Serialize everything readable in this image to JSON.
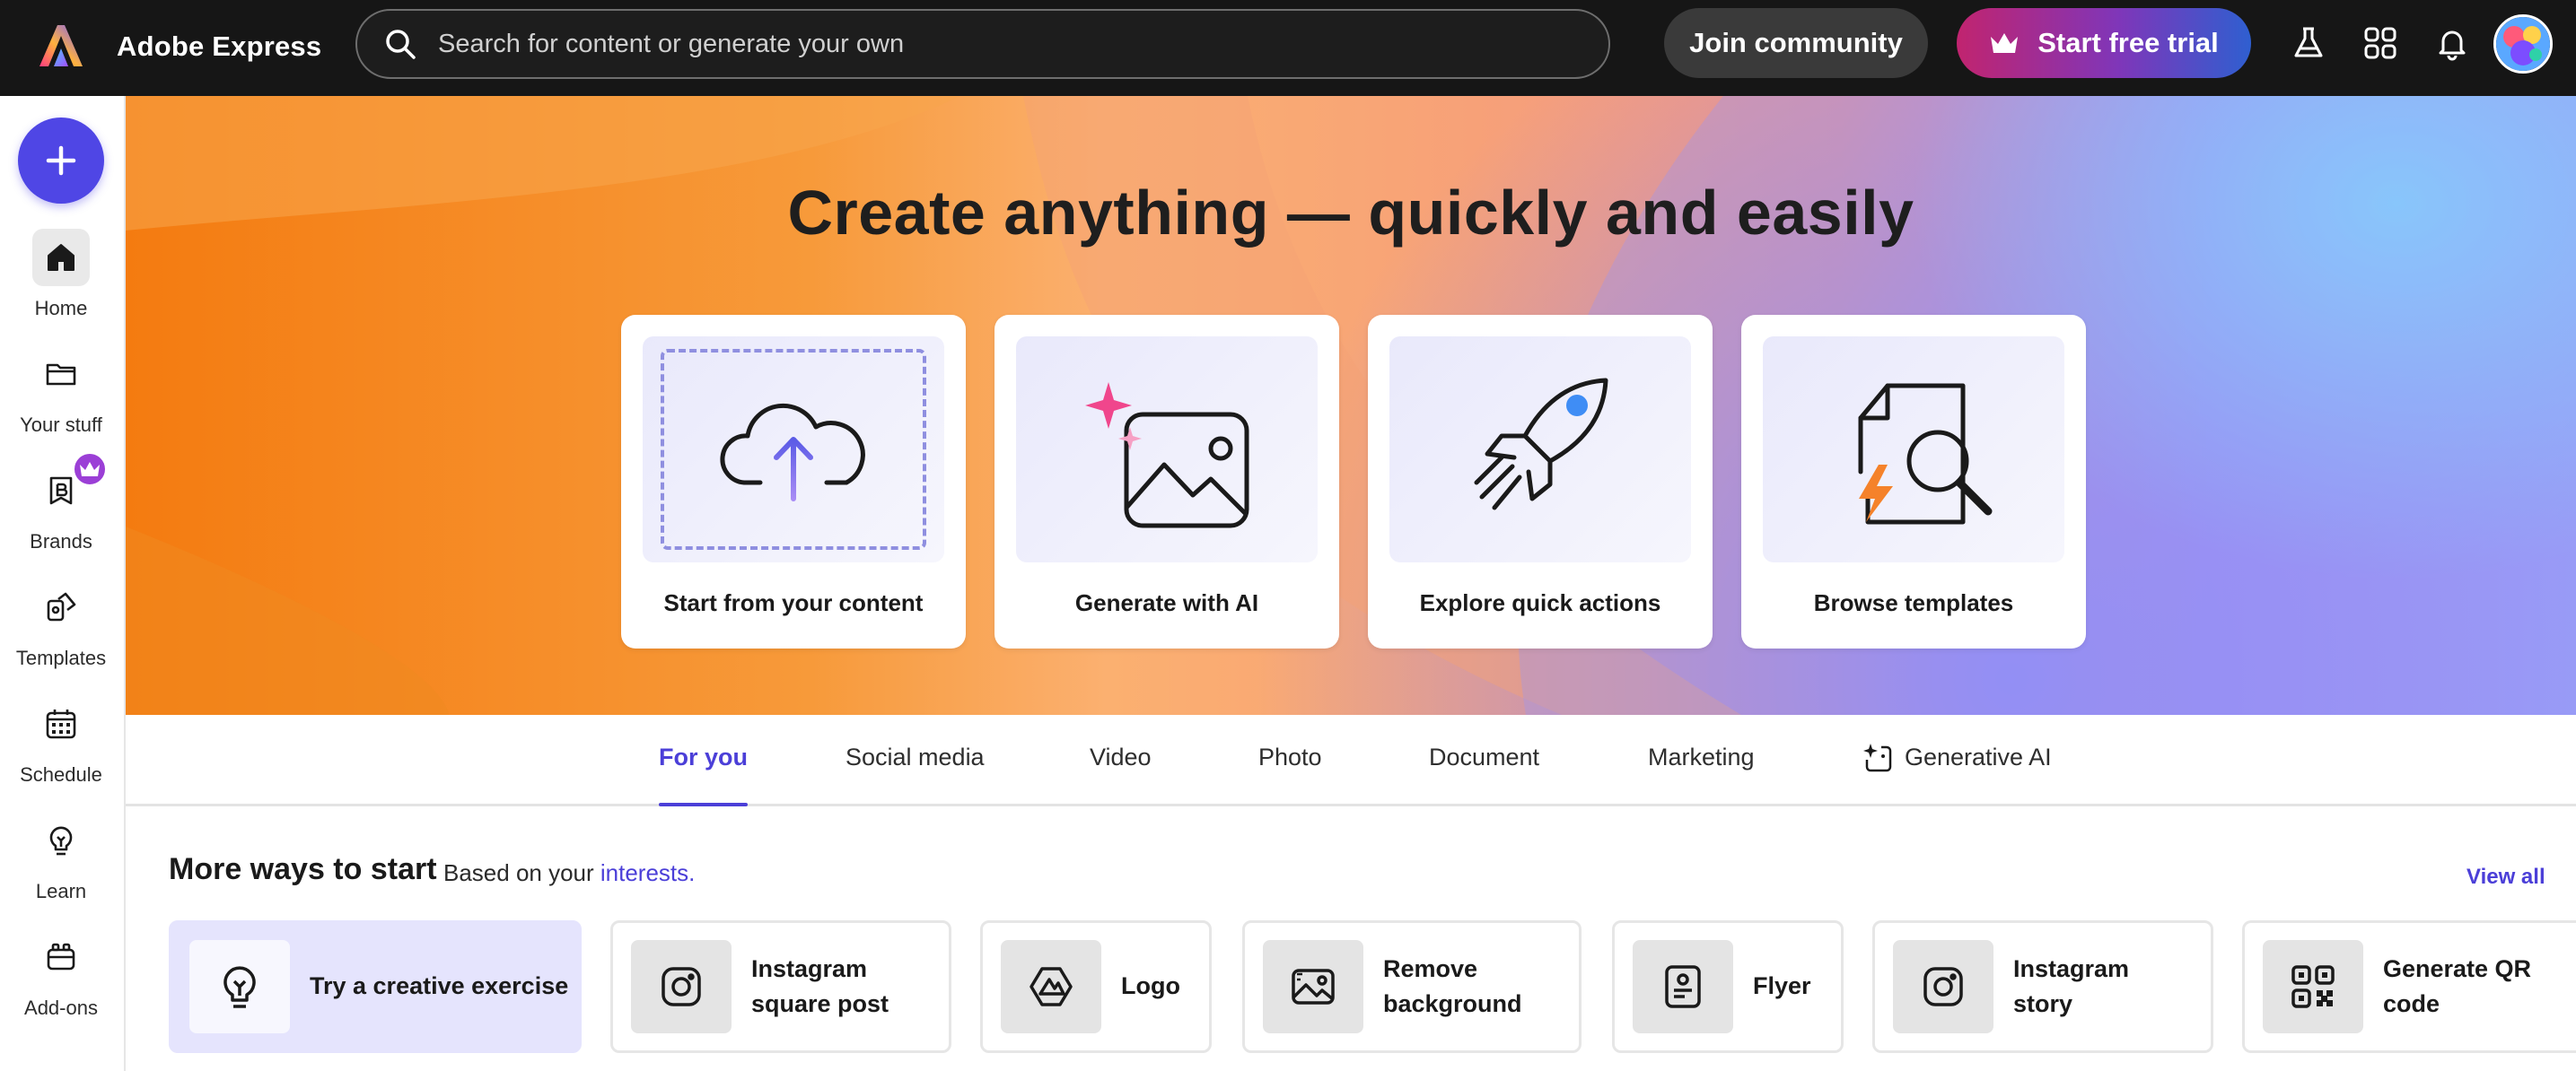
{
  "app": {
    "name": "Adobe Express"
  },
  "topbar": {
    "search_placeholder": "Search for content or generate your own",
    "join_label": "Join community",
    "trial_label": "Start free trial"
  },
  "rail": {
    "items": [
      {
        "label": "Home",
        "icon": "home-icon"
      },
      {
        "label": "Your stuff",
        "icon": "folder-icon"
      },
      {
        "label": "Brands",
        "icon": "brand-icon"
      },
      {
        "label": "Templates",
        "icon": "templates-icon"
      },
      {
        "label": "Schedule",
        "icon": "calendar-icon"
      },
      {
        "label": "Learn",
        "icon": "lightbulb-icon"
      },
      {
        "label": "Add-ons",
        "icon": "addons-icon"
      }
    ]
  },
  "hero": {
    "title": "Create anything — quickly and easily",
    "cards": [
      {
        "label": "Start from your content",
        "icon": "cloud-upload-icon"
      },
      {
        "label": "Generate with AI",
        "icon": "ai-image-icon"
      },
      {
        "label": "Explore quick actions",
        "icon": "rocket-icon"
      },
      {
        "label": "Browse templates",
        "icon": "template-search-icon"
      }
    ]
  },
  "tabs": [
    {
      "label": "For you",
      "active": true
    },
    {
      "label": "Social media"
    },
    {
      "label": "Video"
    },
    {
      "label": "Photo"
    },
    {
      "label": "Document"
    },
    {
      "label": "Marketing"
    },
    {
      "label": "Generative AI"
    }
  ],
  "more_ways": {
    "title": "More ways to start",
    "subtitle_prefix": "Based on your ",
    "subtitle_link": "interests.",
    "view_all": "View all",
    "items": [
      {
        "line1": "Try a creative exercise",
        "line2": "",
        "icon": "lightbulb-icon"
      },
      {
        "line1": "Instagram",
        "line2": "square post",
        "icon": "instagram-icon"
      },
      {
        "line1": "Logo",
        "line2": "",
        "icon": "logo-icon"
      },
      {
        "line1": "Remove",
        "line2": "background",
        "icon": "remove-background-icon"
      },
      {
        "line1": "Flyer",
        "line2": "",
        "icon": "flyer-icon"
      },
      {
        "line1": "Instagram",
        "line2": "story",
        "icon": "instagram-icon"
      },
      {
        "line1": "Generate QR",
        "line2": "code",
        "icon": "qr-code-icon"
      }
    ]
  },
  "colors": {
    "accent": "#4B3FD8",
    "fab": "#4F46E5",
    "topbar": "#161616"
  }
}
